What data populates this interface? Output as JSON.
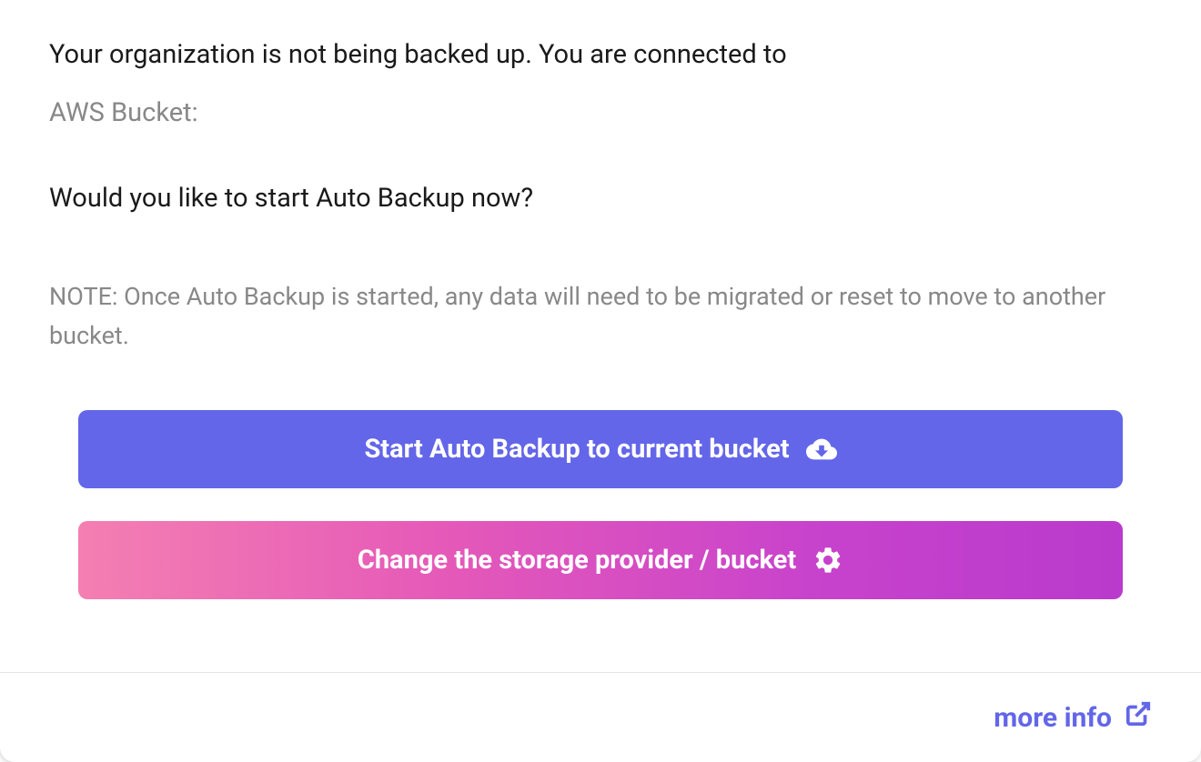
{
  "status": {
    "message": "Your organization is not being backed up. You are connected to",
    "bucket_label": "AWS Bucket:"
  },
  "prompt": {
    "question": "Would you like to start Auto Backup now?",
    "note": "NOTE: Once Auto Backup is started, any data will need to be migrated or reset to move to another bucket."
  },
  "buttons": {
    "start_backup": "Start Auto Backup to current bucket",
    "change_provider": "Change the storage provider / bucket"
  },
  "footer": {
    "more_info": "more info"
  },
  "colors": {
    "primary": "#6366E8",
    "gradient_start": "#F47FB2",
    "gradient_end": "#B93ACC",
    "text_muted": "#888888"
  }
}
